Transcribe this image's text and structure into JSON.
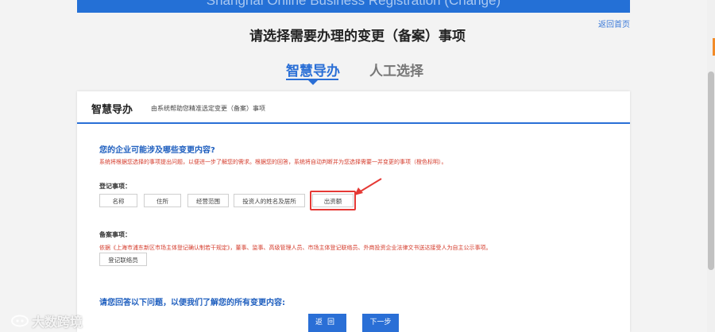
{
  "banner": {
    "text": "Shanghai Online Business Registration (Change)"
  },
  "header": {
    "home_link": "返回首页",
    "page_title": "请选择需要办理的变更（备案）事项"
  },
  "tabs": [
    {
      "label": "智慧导办",
      "active": true
    },
    {
      "label": "人工选择",
      "active": false
    }
  ],
  "card": {
    "title": "智慧导办",
    "subtitle": "由系统帮助您精准选定变更（备案）事项",
    "question1": "您的企业可能涉及哪些变更内容?",
    "note": "系统将根据您选择的事项提出问题，以便进一步了解您的需求。根据您的回答，系统将自动判断并为您选择需要一并变更的事项（橙色标明）。",
    "registration_label": "登记事项：",
    "registration_items": [
      "名称",
      "住所",
      "经营范围",
      "投资人的姓名及居所",
      "出资额"
    ],
    "filing_label": "备案事项：",
    "filing_note": "依据《上海市浦东新区市场主体登记确认制若干规定》，董事、监事、高级管理人员、市场主体登记联络员、外商投资企业法律文书送达接受人为自主公示事项。",
    "filing_items": [
      "登记联络员"
    ],
    "question2": "请您回答以下问题，以便我们了解您的所有变更内容:",
    "back_button": "返回",
    "next_button": "下一步"
  },
  "watermark": {
    "text": "大数跨境"
  },
  "colors": {
    "accent": "#2a6fd6",
    "banner": "#2470d6",
    "warning_text": "#d43a2a",
    "highlight_box": "#e53935"
  }
}
